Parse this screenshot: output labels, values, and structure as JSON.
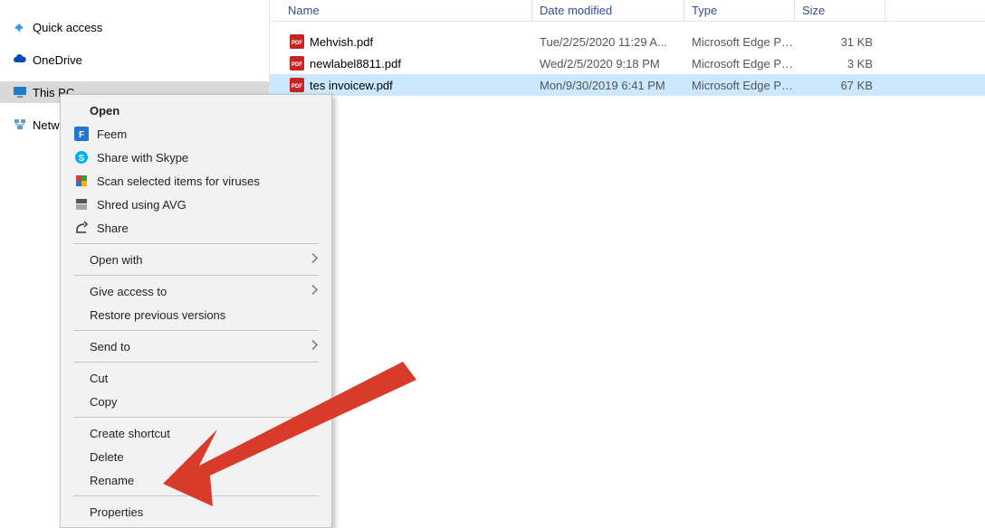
{
  "nav": {
    "quick_access": "Quick access",
    "onedrive": "OneDrive",
    "this_pc": "This PC",
    "network": "Netw"
  },
  "columns": {
    "name": "Name",
    "date": "Date modified",
    "type": "Type",
    "size": "Size"
  },
  "files": [
    {
      "name": "Mehvish.pdf",
      "date": "Tue/2/25/2020 11:29 A...",
      "type": "Microsoft Edge PD...",
      "size": "31 KB"
    },
    {
      "name": "newlabel8811.pdf",
      "date": "Wed/2/5/2020 9:18 PM",
      "type": "Microsoft Edge PD...",
      "size": "3 KB"
    },
    {
      "name": "tes invoicew.pdf",
      "date": "Mon/9/30/2019 6:41 PM",
      "type": "Microsoft Edge PD...",
      "size": "67 KB"
    }
  ],
  "menu": {
    "open": "Open",
    "feem": "Feem",
    "skype": "Share with Skype",
    "scan": "Scan selected items for viruses",
    "shred": "Shred using AVG",
    "share": "Share",
    "open_with": "Open with",
    "give_access": "Give access to",
    "restore": "Restore previous versions",
    "send_to": "Send to",
    "cut": "Cut",
    "copy": "Copy",
    "create_shortcut": "Create shortcut",
    "delete": "Delete",
    "rename": "Rename",
    "properties": "Properties"
  },
  "colors": {
    "selection": "#cce8ff",
    "nav_selected": "#d9d9d9",
    "header_text": "#2f4e8f",
    "arrow": "#d83b2a"
  }
}
